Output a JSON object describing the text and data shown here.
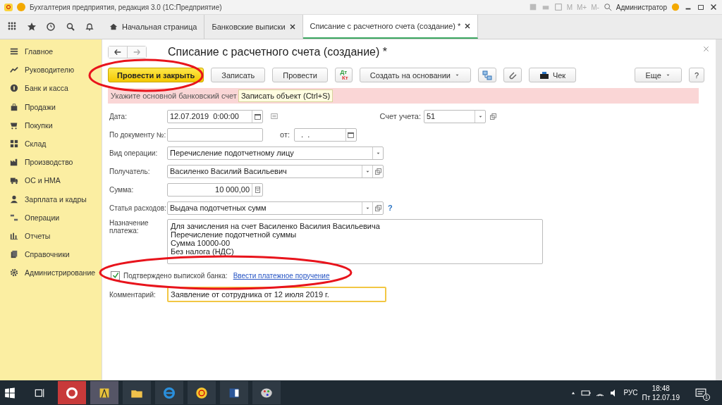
{
  "window": {
    "title": "Бухгалтерия предприятия, редакция 3.0  (1С:Предприятие)",
    "user": "Администратор",
    "memory_keys": [
      "M",
      "M+",
      "M-"
    ]
  },
  "tabs": [
    {
      "label": "Начальная страница",
      "selected": false,
      "closable": false
    },
    {
      "label": "Банковские выписки",
      "selected": false,
      "closable": true
    },
    {
      "label": "Списание с расчетного счета (создание) *",
      "selected": true,
      "closable": true
    }
  ],
  "sidebar": {
    "items": [
      {
        "label": "Главное"
      },
      {
        "label": "Руководителю"
      },
      {
        "label": "Банк и касса"
      },
      {
        "label": "Продажи"
      },
      {
        "label": "Покупки"
      },
      {
        "label": "Склад"
      },
      {
        "label": "Производство"
      },
      {
        "label": "ОС и НМА"
      },
      {
        "label": "Зарплата и кадры"
      },
      {
        "label": "Операции"
      },
      {
        "label": "Отчеты"
      },
      {
        "label": "Справочники"
      },
      {
        "label": "Администрирование"
      }
    ]
  },
  "form": {
    "title": "Списание с расчетного счета (создание) *",
    "buttons": [
      {
        "kind": "default",
        "label": "Провести и закрыть"
      },
      {
        "kind": "normal",
        "label": "Записать"
      },
      {
        "kind": "normal",
        "label": "Провести"
      },
      {
        "kind": "dtkt",
        "label": "Дт",
        "label2": "Кт"
      },
      {
        "kind": "menu",
        "label": "Создать на основании"
      },
      {
        "kind": "structure"
      },
      {
        "kind": "attach"
      },
      {
        "kind": "receipt",
        "label": "Чек"
      }
    ],
    "more_button": "Еще",
    "help_button": "?",
    "warning": "Укажите основной банковский счет",
    "tooltip": "Записать объект (Ctrl+S)",
    "date": {
      "label": "Дата:",
      "value": "12.07.2019  0:00:00"
    },
    "account": {
      "label": "Счет учета:",
      "value": "51"
    },
    "doc_number": {
      "label": "По документу №:"
    },
    "doc_date": {
      "label": "от:",
      "value": "  .  ."
    },
    "operation": {
      "label": "Вид операции:",
      "value": "Перечисление подотчетному лицу"
    },
    "recipient": {
      "label": "Получатель:",
      "value": "Василенко Василий Васильевич"
    },
    "amount": {
      "label": "Сумма:",
      "value": "10 000,00"
    },
    "expense": {
      "label": "Статья расходов:",
      "value": "Выдача подотчетных сумм",
      "help": "?"
    },
    "purpose": {
      "label": "Назначение платежа:",
      "lines": [
        "Для зачисления на счет Василенко Василия Васильевича",
        "Перечисление подотчетной суммы",
        "Сумма 10000-00",
        "Без налога (НДС)"
      ]
    },
    "confirmed": {
      "label": "Подтверждено выпиской банка:",
      "checked": true,
      "link": "Ввести платежное поручение"
    },
    "comment": {
      "label": "Комментарий:",
      "value": "Заявление от сотрудника от 12 июля 2019 г.",
      "focused": true
    }
  },
  "taskbar": {
    "language": "РУС",
    "time": "18:48",
    "date": "Пт 12.07.19",
    "notifications": "1"
  }
}
